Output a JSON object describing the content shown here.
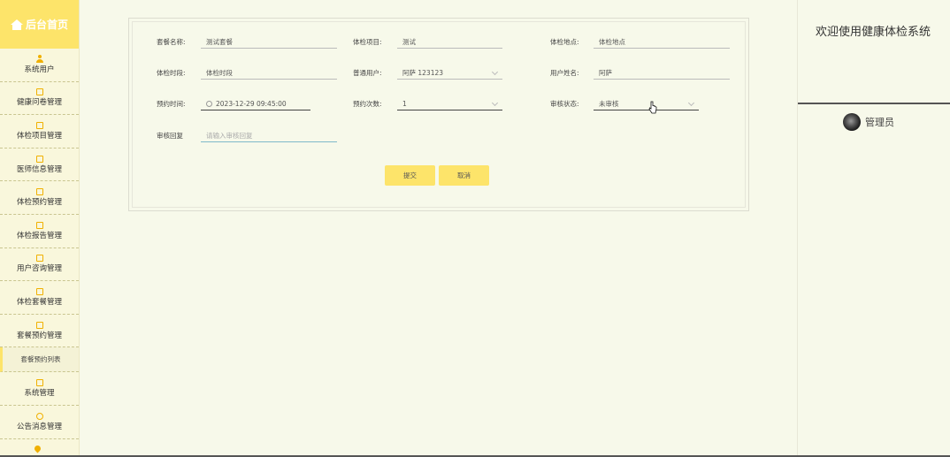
{
  "sidebar": {
    "home_label": "后台首页",
    "items": [
      {
        "label": "系统用户",
        "icon": "user-icon"
      },
      {
        "label": "健康问卷管理",
        "icon": "edit-icon"
      },
      {
        "label": "体检项目管理",
        "icon": "edit-icon"
      },
      {
        "label": "医师信息管理",
        "icon": "edit-icon"
      },
      {
        "label": "体检预约管理",
        "icon": "edit-icon"
      },
      {
        "label": "体检报告管理",
        "icon": "edit-icon"
      },
      {
        "label": "用户咨询管理",
        "icon": "edit-icon"
      },
      {
        "label": "体检套餐管理",
        "icon": "edit-icon"
      },
      {
        "label": "套餐预约管理",
        "icon": "edit-icon"
      },
      {
        "label": "系统管理",
        "icon": "settings-icon"
      },
      {
        "label": "公告消息管理",
        "icon": "info-icon"
      }
    ],
    "active_sub": "套餐预约列表"
  },
  "header": {
    "welcome": "欢迎使用健康体检系统",
    "admin_name": "管理员"
  },
  "form": {
    "package_name": {
      "label": "套餐名称:",
      "value": "测试套餐"
    },
    "exam_item": {
      "label": "体检项目:",
      "value": "测试"
    },
    "exam_location": {
      "label": "体检地点:",
      "value": "体检地点"
    },
    "exam_period": {
      "label": "体检时段:",
      "value": "体检时段"
    },
    "normal_user": {
      "label": "普通用户:",
      "value": "阿萨 123123"
    },
    "user_name": {
      "label": "用户姓名:",
      "value": "阿萨"
    },
    "booking_time": {
      "label": "预约时间:",
      "value": "2023-12-29 09:45:00"
    },
    "booking_count": {
      "label": "预约次数:",
      "value": "1"
    },
    "review_status": {
      "label": "审核状态:",
      "value": "未审核"
    },
    "review_reply": {
      "label": "审核回复",
      "placeholder": "请输入审核回复"
    },
    "submit_label": "提交",
    "cancel_label": "取消"
  }
}
